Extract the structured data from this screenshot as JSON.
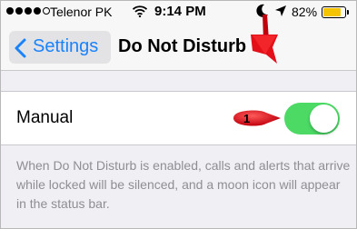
{
  "status_bar": {
    "carrier": "Telenor PK",
    "time": "9:14 PM",
    "battery_percent": "82%",
    "battery_level": 0.82,
    "signal_bars_filled": 4,
    "signal_bars_total": 5,
    "icons": [
      "wifi-icon",
      "moon-icon",
      "location-arrow-icon",
      "battery-icon"
    ]
  },
  "nav": {
    "back_label": "Settings",
    "title": "Do Not Disturb"
  },
  "settings": {
    "manual_label": "Manual",
    "manual_enabled": true,
    "description": "When Do Not Disturb is enabled, calls and alerts that arrive while locked will be silenced, and a moon icon will appear in the status bar."
  },
  "annotation": {
    "badge_number": "1",
    "color": "#e3101a"
  },
  "colors": {
    "accent": "#1a82fb",
    "toggle_on": "#4cd964",
    "background": "#efeff4"
  }
}
